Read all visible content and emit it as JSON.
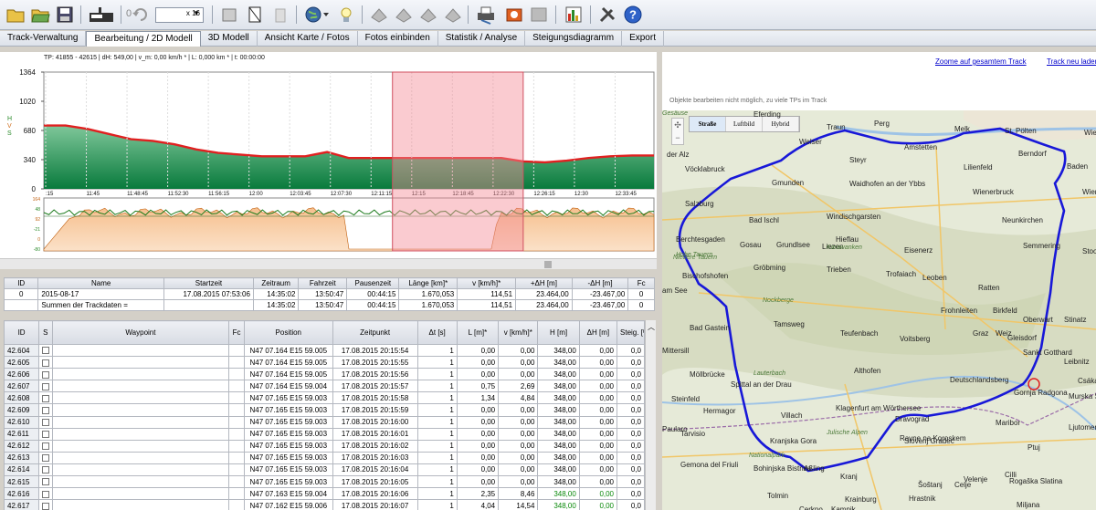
{
  "toolbar": {
    "zoom_value": "0",
    "zoom_select": "x 16"
  },
  "menu": [
    "Track-Verwaltung",
    "Bearbeitung / 2D Modell",
    "3D Modell",
    "Ansicht Karte / Fotos",
    "Fotos einbinden",
    "Statistik / Analyse",
    "Steigungsdiagramm",
    "Export"
  ],
  "chart": {
    "info": "TP: 41855 - 42615 | dH: 549,00 | v_m: 0,00 km/h * | L: 0,000 km * | t: 00:00:00",
    "axis_letters": [
      "H",
      "V",
      "S"
    ],
    "y_ticks": [
      "1364",
      "1020",
      "680",
      "340",
      "0"
    ],
    "x_ticks": [
      ":15",
      "11:45",
      "11:48:45",
      "11:52:30",
      "11:56:15",
      "12:00",
      "12:03:45",
      "12:07:30",
      "12:11:15",
      "12:15",
      "12:18:45",
      "12:22:30",
      "12:26:15",
      "12:30",
      "12:33:45"
    ],
    "small_ticks": [
      "164",
      "48",
      "92",
      "-21",
      "0",
      "-80"
    ]
  },
  "chart_data": {
    "type": "area",
    "title": "",
    "xlabel": "",
    "ylabel": "H",
    "ylim": [
      0,
      1364
    ],
    "x": [
      0,
      0.5,
      1,
      1.5,
      2,
      2.5,
      3,
      3.5,
      4,
      4.5,
      5,
      5.5,
      6,
      6.5,
      7,
      7.5,
      8,
      8.5,
      9,
      9.5,
      10,
      10.5,
      11,
      11.5,
      12,
      12.5,
      13,
      13.5,
      14
    ],
    "series": [
      {
        "name": "H",
        "values": [
          740,
          740,
          700,
          640,
          580,
          560,
          520,
          460,
          420,
          400,
          380,
          380,
          380,
          430,
          360,
          360,
          360,
          360,
          360,
          360,
          360,
          360,
          320,
          310,
          330,
          360,
          380,
          390,
          390
        ]
      }
    ],
    "selection": [
      8,
      11
    ]
  },
  "summary": {
    "headers": [
      "ID",
      "Name",
      "Startzeit",
      "Zeitraum",
      "Fahrzeit",
      "Pausenzeit",
      "Länge [km]*",
      "v [km/h]*",
      "+ΔH [m]",
      "-ΔH [m]",
      "Fc"
    ],
    "rows": [
      [
        "0",
        "2015-08-17",
        "17.08.2015 07:53:06",
        "14:35:02",
        "13:50:47",
        "00:44:15",
        "1.670,053",
        "114,51",
        "23.464,00",
        "-23.467,00",
        "0"
      ],
      [
        "",
        "Summen der Trackdaten =",
        "",
        "14:35:02",
        "13:50:47",
        "00:44:15",
        "1.670,053",
        "114,51",
        "23.464,00",
        "-23.467,00",
        "0"
      ]
    ]
  },
  "waypoints": {
    "headers": [
      "ID",
      "S",
      "Waypoint",
      "Fc",
      "Position",
      "Zeitpunkt",
      "Δt [s]",
      "L [m]*",
      "v [km/h]*",
      "H [m]",
      "ΔH [m]",
      "Steig. [%]"
    ],
    "rows": [
      [
        "42.604",
        "",
        "",
        "",
        "N47 07.164 E15 59.005",
        "17.08.2015 20:15:54",
        "1",
        "0,00",
        "0,00",
        "348,00",
        "0,00",
        "0,0"
      ],
      [
        "42.605",
        "",
        "",
        "",
        "N47 07.164 E15 59.005",
        "17.08.2015 20:15:55",
        "1",
        "0,00",
        "0,00",
        "348,00",
        "0,00",
        "0,0"
      ],
      [
        "42.606",
        "",
        "",
        "",
        "N47 07.164 E15 59.005",
        "17.08.2015 20:15:56",
        "1",
        "0,00",
        "0,00",
        "348,00",
        "0,00",
        "0,0"
      ],
      [
        "42.607",
        "",
        "",
        "",
        "N47 07.164 E15 59.004",
        "17.08.2015 20:15:57",
        "1",
        "0,75",
        "2,69",
        "348,00",
        "0,00",
        "0,0"
      ],
      [
        "42.608",
        "",
        "",
        "",
        "N47 07.165 E15 59.003",
        "17.08.2015 20:15:58",
        "1",
        "1,34",
        "4,84",
        "348,00",
        "0,00",
        "0,0"
      ],
      [
        "42.609",
        "",
        "",
        "",
        "N47 07.165 E15 59.003",
        "17.08.2015 20:15:59",
        "1",
        "0,00",
        "0,00",
        "348,00",
        "0,00",
        "0,0"
      ],
      [
        "42.610",
        "",
        "",
        "",
        "N47 07.165 E15 59.003",
        "17.08.2015 20:16:00",
        "1",
        "0,00",
        "0,00",
        "348,00",
        "0,00",
        "0,0"
      ],
      [
        "42.611",
        "",
        "",
        "",
        "N47 07.165 E15 59.003",
        "17.08.2015 20:16:01",
        "1",
        "0,00",
        "0,00",
        "348,00",
        "0,00",
        "0,0"
      ],
      [
        "42.612",
        "",
        "",
        "",
        "N47 07.165 E15 59.003",
        "17.08.2015 20:16:02",
        "1",
        "0,00",
        "0,00",
        "348,00",
        "0,00",
        "0,0"
      ],
      [
        "42.613",
        "",
        "",
        "",
        "N47 07.165 E15 59.003",
        "17.08.2015 20:16:03",
        "1",
        "0,00",
        "0,00",
        "348,00",
        "0,00",
        "0,0"
      ],
      [
        "42.614",
        "",
        "",
        "",
        "N47 07.165 E15 59.003",
        "17.08.2015 20:16:04",
        "1",
        "0,00",
        "0,00",
        "348,00",
        "0,00",
        "0,0"
      ],
      [
        "42.615",
        "",
        "",
        "",
        "N47 07.165 E15 59.003",
        "17.08.2015 20:16:05",
        "1",
        "0,00",
        "0,00",
        "348,00",
        "0,00",
        "0,0"
      ],
      [
        "42.616",
        "",
        "",
        "",
        "N47 07.163 E15 59.004",
        "17.08.2015 20:16:06",
        "1",
        "2,35",
        "8,46",
        "348,00",
        "0,00",
        "0,0"
      ],
      [
        "42.617",
        "",
        "",
        "",
        "N47 07.162 E15 59.006",
        "17.08.2015 20:16:07",
        "1",
        "4,04",
        "14,54",
        "348,00",
        "0,00",
        "0,0"
      ]
    ]
  },
  "map": {
    "zoom_link": "Zoome auf gesamtem Track",
    "reload_link": "Track neu laden",
    "note": "Objekte bearbeiten nicht möglich, zu viele TPs im Track",
    "types": [
      "Straße",
      "Luftbild",
      "Hybrid"
    ],
    "nav": [
      "✣",
      "−"
    ],
    "cities": [
      "Eferding",
      "Traun",
      "Perg",
      "Melk",
      "St. Pölten",
      "Wien",
      "Welser",
      "Amstetten",
      "Steyr",
      "Lilienfeld",
      "Berndorf",
      "Baden",
      "Vöcklabruck",
      "Gmunden",
      "Waidhofen an der Ybbs",
      "Wienerbruck",
      "Wiener Neustadt",
      "der Alz",
      "Salzburg",
      "Bad Ischl",
      "Windischgarsten",
      "Neunkirchen",
      "Berchtesgaden",
      "Gosau",
      "Grundlsee",
      "Liezen",
      "Hieflau",
      "Eisenerz",
      "Semmering",
      "Stoob",
      "Gröbming",
      "Trieben",
      "Trofaiach",
      "Leoben",
      "Ratten",
      "Bischofshofen",
      "Birkfeld",
      "Oberwart",
      "am See",
      "Weiz",
      "Stinatz",
      "Tamsweg",
      "Teufenbach",
      "Frohnleiten",
      "Bad Gastein",
      "Voitsberg",
      "Graz",
      "Gleisdorf",
      "Sankt Gotthard",
      "Mittersill",
      "Leibnitz",
      "Csákánkisi",
      "Möllbrücke",
      "Althofen",
      "Deutschlandsberg",
      "Spittal an der Drau",
      "Gornja Radgona",
      "Murska Sobota",
      "Hermagor",
      "Villach",
      "Klagenfurt am Wörthersee",
      "Dravograd",
      "Maribor",
      "Ljutomer",
      "Paularo",
      "Tarvisio",
      "Kranjska Gora",
      "Ravne na Koroskem",
      "Slovenj Gradec",
      "Ptuj",
      "Gemona del Friuli",
      "Bohinjska Bistrica",
      "Aßling",
      "Kranj",
      "Šoštanj",
      "Velenje",
      "Celje",
      "Cilli",
      "Rogaška Slatina",
      "Tolmin",
      "Krainburg",
      "Kamnik",
      "Hrastnik",
      "Miljana",
      "Cerkno",
      "Steinfeld",
      "Lauterbach",
      "Nockberge",
      "Niedere Tauern",
      "Hohe Tauern",
      "Nationalpark",
      "Julische Alpen",
      "Karawanken",
      "Gesäuse"
    ]
  }
}
